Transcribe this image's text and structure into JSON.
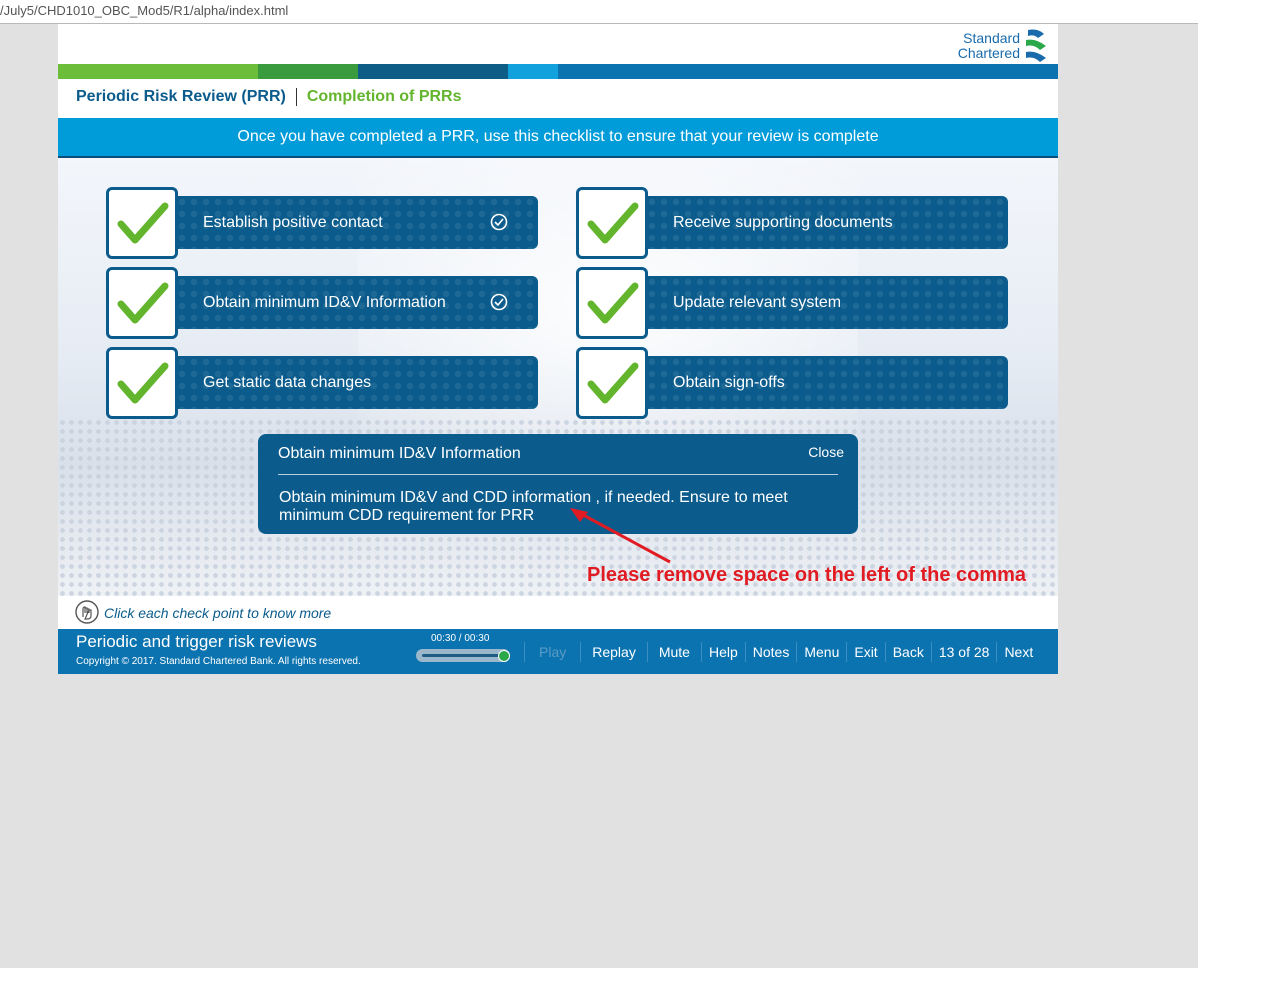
{
  "browser": {
    "url": "/July5/CHD1010_OBC_Mod5/R1/alpha/index.html"
  },
  "logo": {
    "line1": "Standard",
    "line2": "Chartered"
  },
  "breadcrumb": {
    "course": "Periodic Risk Review (PRR)",
    "topic": "Completion of PRRs"
  },
  "banner": {
    "text": "Once you have completed a PRR, use this checklist to ensure that your review is complete"
  },
  "checklist": [
    {
      "label": "Establish positive contact",
      "visited": true
    },
    {
      "label": "Receive supporting documents",
      "visited": false
    },
    {
      "label": "Obtain minimum ID&V Information",
      "visited": true
    },
    {
      "label": "Update relevant system",
      "visited": false
    },
    {
      "label": "Get static data changes",
      "visited": false
    },
    {
      "label": "Obtain sign-offs",
      "visited": false
    }
  ],
  "popup": {
    "title": "Obtain minimum ID&V Information",
    "close_label": "Close",
    "body": "Obtain minimum ID&V and CDD information , if needed. Ensure to meet minimum CDD requirement for PRR"
  },
  "hint": {
    "text": "Click each check point to know more"
  },
  "footer": {
    "title": "Periodic and trigger risk reviews",
    "copyright": "Copyright © 2017. Standard Chartered Bank. All rights reserved.",
    "time": "00:30 / 00:30",
    "progress": 1.0
  },
  "nav": {
    "play": "Play",
    "replay": "Replay",
    "mute": "Mute",
    "help": "Help",
    "notes": "Notes",
    "menu": "Menu",
    "exit": "Exit",
    "back": "Back",
    "page": "13 of 28",
    "next": "Next"
  },
  "annotation": {
    "text": "Please remove space on the left of the comma"
  },
  "colors": {
    "navy": "#0b5c8c",
    "banner": "#009cd9",
    "footer": "#0b73b0",
    "check": "#63b52e",
    "annotation": "#e11b22"
  }
}
